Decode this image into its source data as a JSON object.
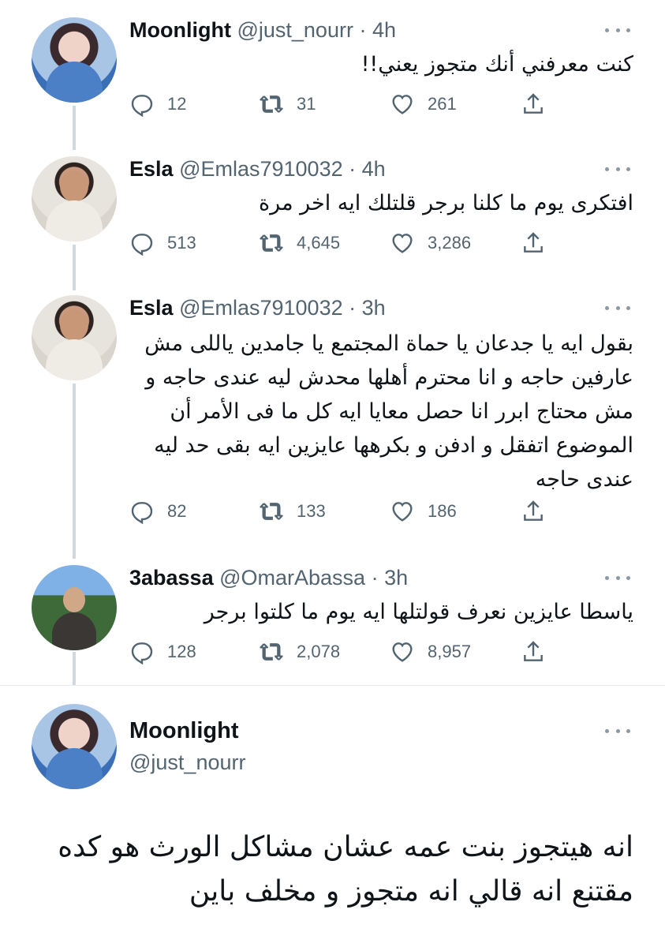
{
  "replies": [
    {
      "name": "Moonlight",
      "handle": "@just_nourr",
      "time": "· 4h",
      "text": "كنت معرفني أنك متجوز يعني!!",
      "reply_count": "12",
      "retweet_count": "31",
      "like_count": "261",
      "avatar": "avatar-moonlight"
    },
    {
      "name": "Esla",
      "handle": "@Emlas7910032",
      "time": "· 4h",
      "text": "افتكرى يوم ما كلنا برجر قلتلك ايه اخر مرة",
      "reply_count": "513",
      "retweet_count": "4,645",
      "like_count": "3,286",
      "avatar": "avatar-esla"
    },
    {
      "name": "Esla",
      "handle": "@Emlas7910032",
      "time": "· 3h",
      "text": "بقول ايه يا جدعان يا حماة المجتمع يا جامدين ياللى مش عارفين حاجه و انا محترم أهلها محدش ليه عندى حاجه و مش محتاج ابرر انا حصل معايا ايه كل ما فى الأمر أن الموضوع اتفقل و ادفن و بكرهها عايزين ايه بقى حد ليه عندى حاجه",
      "reply_count": "82",
      "retweet_count": "133",
      "like_count": "186",
      "avatar": "avatar-esla"
    },
    {
      "name": "3abassa",
      "handle": "@OmarAbassa",
      "time": "· 3h",
      "text": "ياسطا عايزين نعرف قولتلها ايه يوم ما كلتوا برجر",
      "reply_count": "128",
      "retweet_count": "2,078",
      "like_count": "8,957",
      "avatar": "avatar-omar"
    }
  ],
  "main_tweet": {
    "name": "Moonlight",
    "handle": "@just_nourr",
    "text": "انه هيتجوز بنت عمه عشان مشاكل الورث هو كده مقتنع انه قالي انه متجوز و مخلف باين"
  },
  "icons": {
    "reply": "reply-icon",
    "retweet": "retweet-icon",
    "like": "heart-icon",
    "share": "share-icon",
    "more": "more-icon"
  }
}
